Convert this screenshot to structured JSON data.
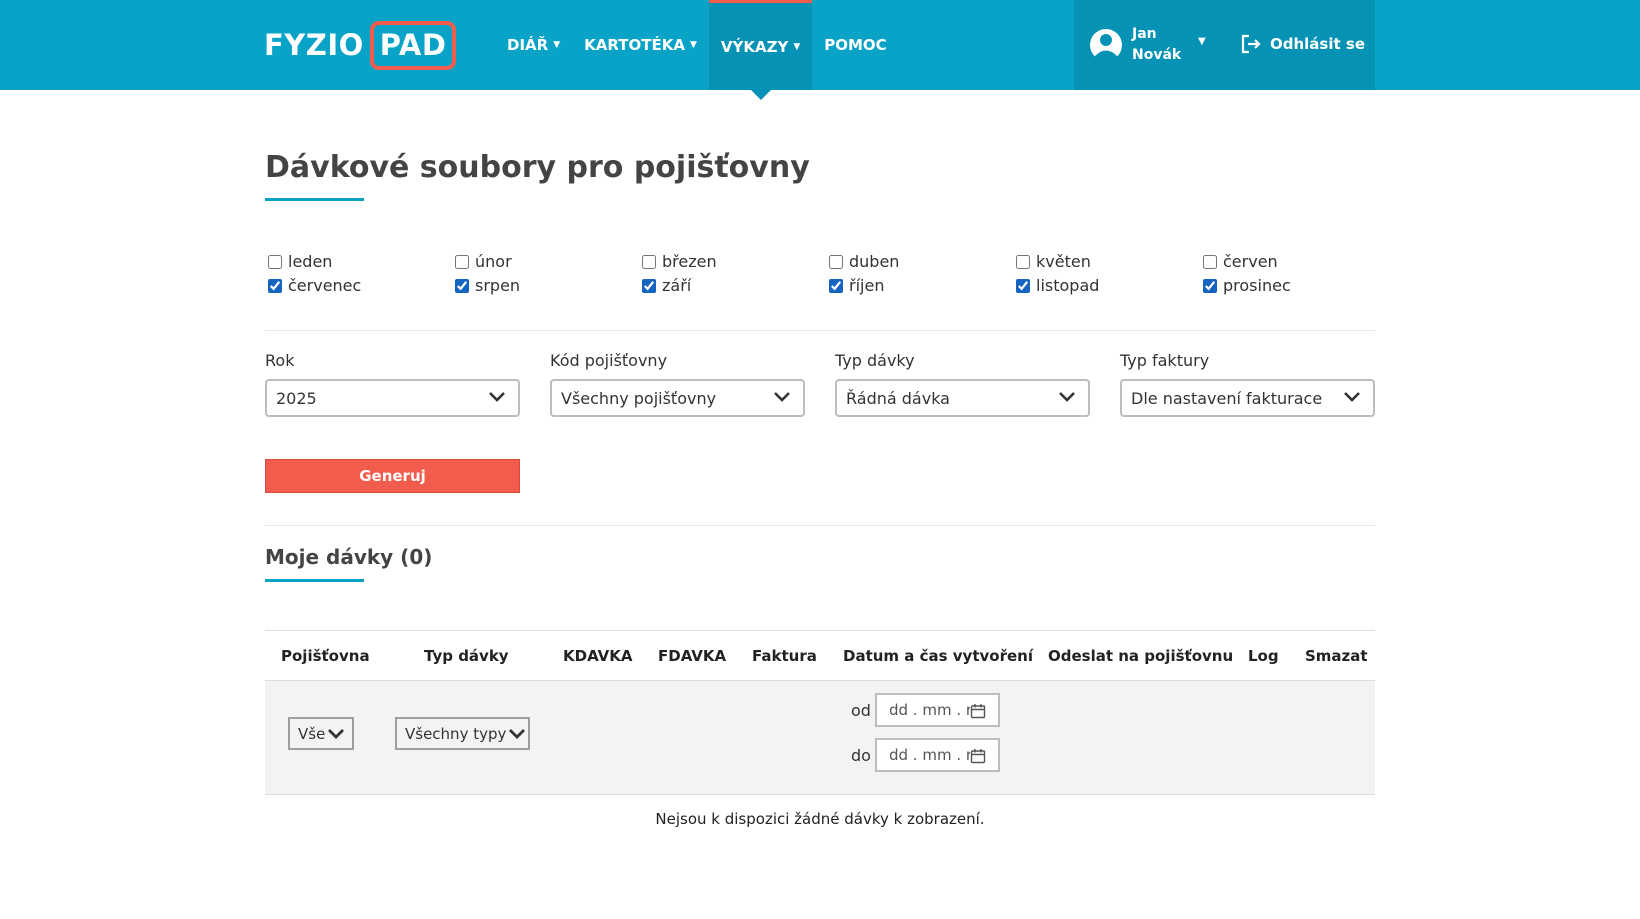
{
  "brand": {
    "part1": "FYZIO",
    "part2": "PAD",
    "accent_color": "#f25c4d",
    "header_color": "#08a3c6"
  },
  "nav": [
    {
      "label": "DIÁŘ",
      "dropdown": true,
      "active": false
    },
    {
      "label": "KARTOTÉKA",
      "dropdown": true,
      "active": false
    },
    {
      "label": "VÝKAZY",
      "dropdown": true,
      "active": true
    },
    {
      "label": "POMOC",
      "dropdown": false,
      "active": false
    }
  ],
  "user": {
    "first_name": "Jan",
    "last_name": "Novák",
    "logout_label": "Odhlásit se"
  },
  "page": {
    "title": "Dávkové soubory pro pojišťovny"
  },
  "months": [
    {
      "label": "leden",
      "checked": false
    },
    {
      "label": "únor",
      "checked": false
    },
    {
      "label": "březen",
      "checked": false
    },
    {
      "label": "duben",
      "checked": false
    },
    {
      "label": "květen",
      "checked": false
    },
    {
      "label": "červen",
      "checked": false
    },
    {
      "label": "červenec",
      "checked": true
    },
    {
      "label": "srpen",
      "checked": true
    },
    {
      "label": "září",
      "checked": true
    },
    {
      "label": "říjen",
      "checked": true
    },
    {
      "label": "listopad",
      "checked": true
    },
    {
      "label": "prosinec",
      "checked": true
    }
  ],
  "filters": {
    "year": {
      "label": "Rok",
      "value": "2025"
    },
    "insurer": {
      "label": "Kód pojišťovny",
      "value": "Všechny pojišťovny"
    },
    "batch_type": {
      "label": "Typ dávky",
      "value": "Řádná dávka"
    },
    "invoice_type": {
      "label": "Typ faktury",
      "value": "Dle nastavení fakturace"
    }
  },
  "generate_label": "Generuj",
  "my_batches": {
    "title": "Moje dávky (0)",
    "columns": [
      "Pojišťovna",
      "Typ dávky",
      "KDAVKA",
      "FDAVKA",
      "Faktura",
      "Datum a čas vytvoření",
      "Odeslat na pojišťovnu",
      "Log",
      "Smazat"
    ],
    "filter_insurer": "Vše",
    "filter_type": "Všechny typy",
    "date_from_label": "od",
    "date_to_label": "do",
    "date_placeholder": "dd . mm . r",
    "empty_message": "Nejsou k dispozici žádné dávky k zobrazení."
  }
}
